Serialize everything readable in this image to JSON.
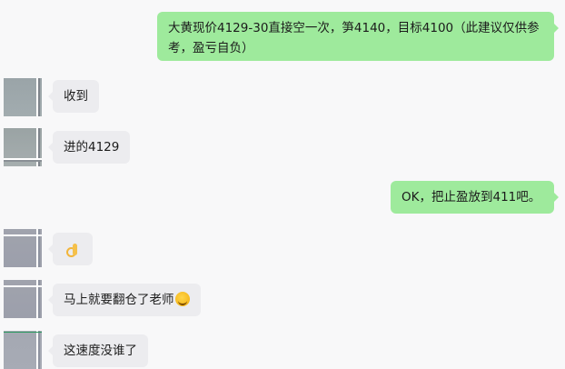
{
  "messages": [
    {
      "side": "out",
      "text_line1": "大黄现价4129-30直接空一次，笋4140，目标4100（此建议仅供参",
      "text_line2": "考，盈亏自负）"
    },
    {
      "side": "in",
      "text": "收到"
    },
    {
      "side": "in",
      "text": "进的4129"
    },
    {
      "side": "out",
      "text": "OK，把止盈放到411吧。"
    },
    {
      "side": "in",
      "emoji": "ok-hand-emoji"
    },
    {
      "side": "in",
      "text": "马上就要翻仓了老师",
      "emoji": "laughing-face-emoji"
    },
    {
      "side": "in",
      "text": "这速度没谁了"
    }
  ],
  "colors": {
    "background": "#f8f8f9",
    "incoming_bubble": "#ececef",
    "outgoing_bubble": "#9eea9c"
  }
}
